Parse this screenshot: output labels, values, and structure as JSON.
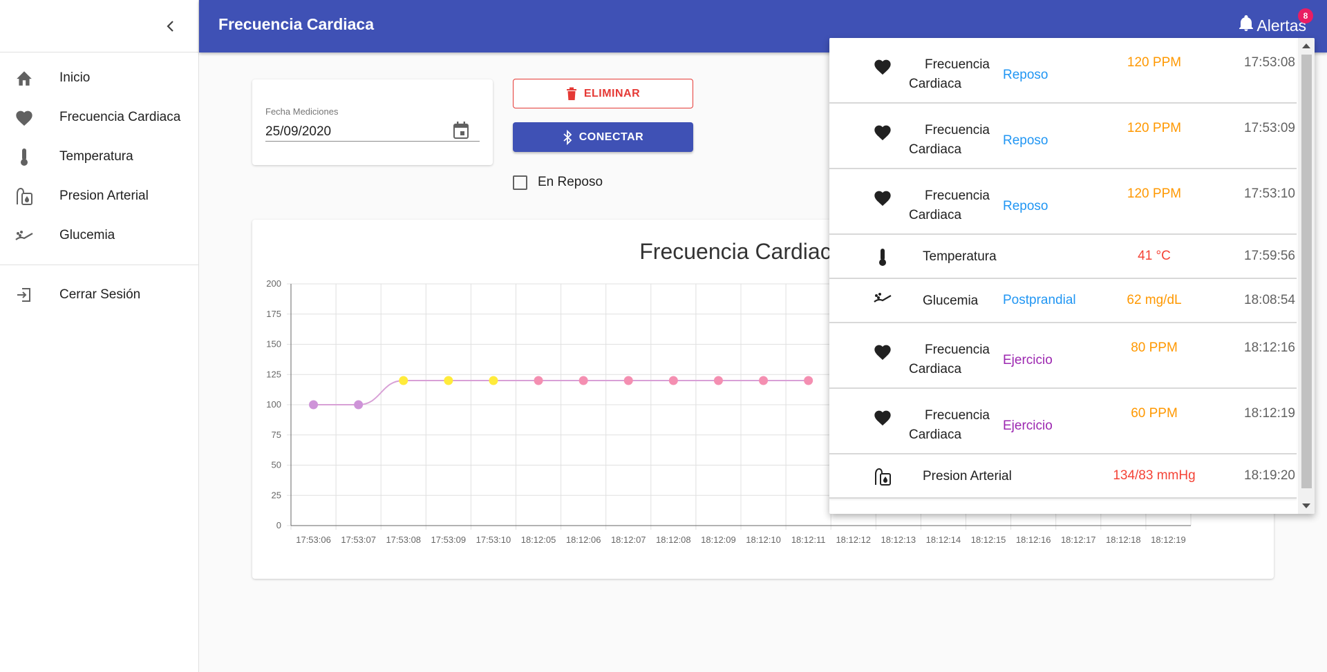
{
  "app": {
    "title": "Frecuencia Cardiaca"
  },
  "header": {
    "alerts_label": "Alertas",
    "alerts_count": "8"
  },
  "sidebar": {
    "items": [
      {
        "label": "Inicio",
        "icon": "home-icon"
      },
      {
        "label": "Frecuencia Cardiaca",
        "icon": "heart-icon"
      },
      {
        "label": "Temperatura",
        "icon": "thermometer-icon"
      },
      {
        "label": "Presion Arterial",
        "icon": "blood-pressure-icon"
      },
      {
        "label": "Glucemia",
        "icon": "glucose-icon"
      }
    ],
    "logout": {
      "label": "Cerrar Sesión",
      "icon": "logout-icon"
    }
  },
  "form": {
    "date_label": "Fecha Mediciones",
    "date_value": "25/09/2020",
    "delete_label": "ELIMINAR",
    "connect_label": "CONECTAR",
    "rest_label": "En Reposo",
    "rest_checked": false
  },
  "colors": {
    "primary": "#3f51b5",
    "danger": "#e53935",
    "badge": "#e91e63",
    "reposo": "#2196f3",
    "ejercicio": "#9c27b0",
    "warning": "#ff9800",
    "critical": "#f44336"
  },
  "chart_data": {
    "type": "line",
    "title": "Frecuencia Cardiaca (PP",
    "categories": [
      "17:53:06",
      "17:53:07",
      "17:53:08",
      "17:53:09",
      "17:53:10",
      "18:12:05",
      "18:12:06",
      "18:12:07",
      "18:12:08",
      "18:12:09",
      "18:12:10",
      "18:12:11",
      "18:12:12",
      "18:12:13",
      "18:12:14",
      "18:12:15",
      "18:12:16",
      "18:12:17",
      "18:12:18",
      "18:12:19"
    ],
    "values": [
      100,
      100,
      120,
      120,
      120,
      120,
      120,
      120,
      120,
      120,
      120,
      120
    ],
    "point_colors": [
      "#ce93d8",
      "#ce93d8",
      "#ffeb3b",
      "#ffeb3b",
      "#ffeb3b",
      "#f48fb1",
      "#f48fb1",
      "#f48fb1",
      "#f48fb1",
      "#f48fb1",
      "#f48fb1",
      "#f48fb1"
    ],
    "ylim": [
      0,
      200
    ],
    "yticks": [
      0,
      25,
      50,
      75,
      100,
      125,
      150,
      175,
      200
    ],
    "grid": true
  },
  "alerts": [
    {
      "type": "Frecuencia\nCardiaca",
      "type_lines": [
        "Frecuencia",
        "Cardiaca"
      ],
      "icon": "heart-icon",
      "condition": "Reposo",
      "condition_color": "#2196f3",
      "value": "120 PPM",
      "value_color": "#ff9800",
      "time": "17:53:08"
    },
    {
      "type_lines": [
        "Frecuencia",
        "Cardiaca"
      ],
      "icon": "heart-icon",
      "condition": "Reposo",
      "condition_color": "#2196f3",
      "value": "120 PPM",
      "value_color": "#ff9800",
      "time": "17:53:09"
    },
    {
      "type_lines": [
        "Frecuencia",
        "Cardiaca"
      ],
      "icon": "heart-icon",
      "condition": "Reposo",
      "condition_color": "#2196f3",
      "value": "120 PPM",
      "value_color": "#ff9800",
      "time": "17:53:10"
    },
    {
      "type_lines": [
        "Temperatura"
      ],
      "icon": "thermometer-icon",
      "condition": "",
      "condition_color": "#2196f3",
      "value": "41 °C",
      "value_color": "#f44336",
      "time": "17:59:56"
    },
    {
      "type_lines": [
        "Glucemia"
      ],
      "icon": "glucose-icon",
      "condition": "Postprandial",
      "condition_color": "#2196f3",
      "value": "62 mg/dL",
      "value_color": "#ff9800",
      "time": "18:08:54"
    },
    {
      "type_lines": [
        "Frecuencia",
        "Cardiaca"
      ],
      "icon": "heart-icon",
      "condition": "Ejercicio",
      "condition_color": "#9c27b0",
      "value": "80 PPM",
      "value_color": "#ff9800",
      "time": "18:12:16"
    },
    {
      "type_lines": [
        "Frecuencia",
        "Cardiaca"
      ],
      "icon": "heart-icon",
      "condition": "Ejercicio",
      "condition_color": "#9c27b0",
      "value": "60 PPM",
      "value_color": "#ff9800",
      "time": "18:12:19"
    },
    {
      "type_lines": [
        "Presion Arterial"
      ],
      "icon": "blood-pressure-icon",
      "condition": "",
      "condition_color": "#2196f3",
      "value": "134/83 mmHg",
      "value_color": "#f44336",
      "time": "18:19:20"
    }
  ]
}
